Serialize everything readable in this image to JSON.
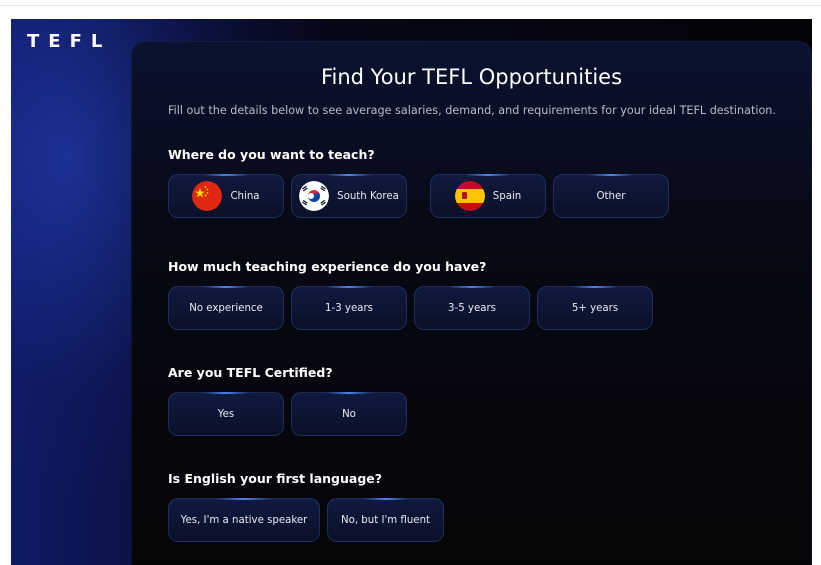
{
  "brand": {
    "logo": "TEFL"
  },
  "page": {
    "title": "Find Your TEFL Opportunities",
    "subtitle": "Fill out the details below to see average salaries, demand, and requirements for your ideal TEFL destination."
  },
  "questions": {
    "location": {
      "label": "Where do you want to teach?",
      "options": [
        "China",
        "South Korea",
        "Spain",
        "Other"
      ],
      "icons": [
        "china-flag-icon",
        "south-korea-flag-icon",
        "spain-flag-icon"
      ]
    },
    "experience": {
      "label": "How much teaching experience do you have?",
      "options": [
        "No experience",
        "1-3 years",
        "3-5 years",
        "5+ years"
      ]
    },
    "certified": {
      "label": "Are you TEFL Certified?",
      "options": [
        "Yes",
        "No"
      ]
    },
    "english": {
      "label": "Is English your first language?",
      "options": [
        "Yes, I'm a native speaker",
        "No, but I'm fluent"
      ]
    }
  },
  "colors": {
    "background_blue": "#0f1a66",
    "panel": "#070914",
    "button": "#101a3f",
    "button_accent": "#508cff",
    "text": "#ffffff"
  }
}
